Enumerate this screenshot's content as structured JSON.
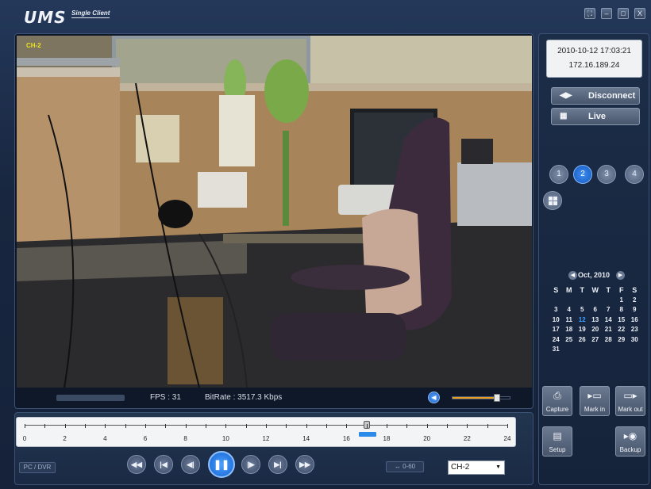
{
  "app": {
    "name": "UMS",
    "subtitle": "Single Client",
    "window_buttons": [
      "fullscreen",
      "minimize",
      "maximize",
      "close"
    ],
    "window_glyphs": {
      "fullscreen": "⛶",
      "minimize": "–",
      "maximize": "□",
      "close": "X"
    }
  },
  "video": {
    "channel_label": "CH-2",
    "fps_label": "FPS : 31",
    "bitrate_label": "BitRate : 3517.3 Kbps",
    "volume": 0.75
  },
  "timeline": {
    "ticks": [
      "0",
      "2",
      "4",
      "6",
      "8",
      "10",
      "12",
      "14",
      "16",
      "18",
      "20",
      "22",
      "24"
    ],
    "position_hour": 17.0,
    "range_label": "0-60",
    "range_icon": "↔"
  },
  "playback": {
    "source_label": "PC / DVR",
    "buttons": [
      {
        "name": "fast-rewind",
        "glyph": "◀◀"
      },
      {
        "name": "skip-start",
        "glyph": "|◀"
      },
      {
        "name": "step-back",
        "glyph": "◀|"
      },
      {
        "name": "step-forward",
        "glyph": "|▶"
      },
      {
        "name": "skip-end",
        "glyph": "▶|"
      },
      {
        "name": "fast-forward",
        "glyph": "▶▶"
      }
    ],
    "pause_glyph": "❚❚",
    "channel_select": "CH-2",
    "select_arrow": "▼"
  },
  "info": {
    "datetime": "2010-10-12 17:03:21",
    "ip": "172.16.189.24"
  },
  "side_buttons": {
    "disconnect": "Disconnect",
    "live": "Live",
    "disconnect_icon": "◀▶",
    "live_icon": "▦"
  },
  "layout_buttons": [
    "1",
    "2",
    "3",
    "4"
  ],
  "active_layout": "2",
  "calendar": {
    "month_label": "Oct, 2010",
    "prev": "◀",
    "next": "▶",
    "weekdays": [
      "S",
      "M",
      "T",
      "W",
      "T",
      "F",
      "S"
    ],
    "days": [
      "",
      "",
      "",
      "",
      "",
      "1",
      "2",
      "3",
      "4",
      "5",
      "6",
      "7",
      "8",
      "9",
      "10",
      "11",
      "12",
      "13",
      "14",
      "15",
      "16",
      "17",
      "18",
      "19",
      "20",
      "21",
      "22",
      "23",
      "24",
      "25",
      "26",
      "27",
      "28",
      "29",
      "30",
      "31",
      "",
      "",
      "",
      "",
      "",
      ""
    ],
    "selected_day": "12"
  },
  "actions": {
    "capture": "Capture",
    "mark_in": "Mark in",
    "mark_out": "Mark out",
    "setup": "Setup",
    "backup": "Backup",
    "capture_icon": "⎙",
    "mark_in_icon": "▸▭",
    "mark_out_icon": "▭▸",
    "setup_icon": "▤",
    "backup_icon": "▸◉"
  },
  "colors": {
    "accent": "#1e6ad8",
    "panel": "#1a2a44",
    "volume_fill": "#e8a020"
  }
}
